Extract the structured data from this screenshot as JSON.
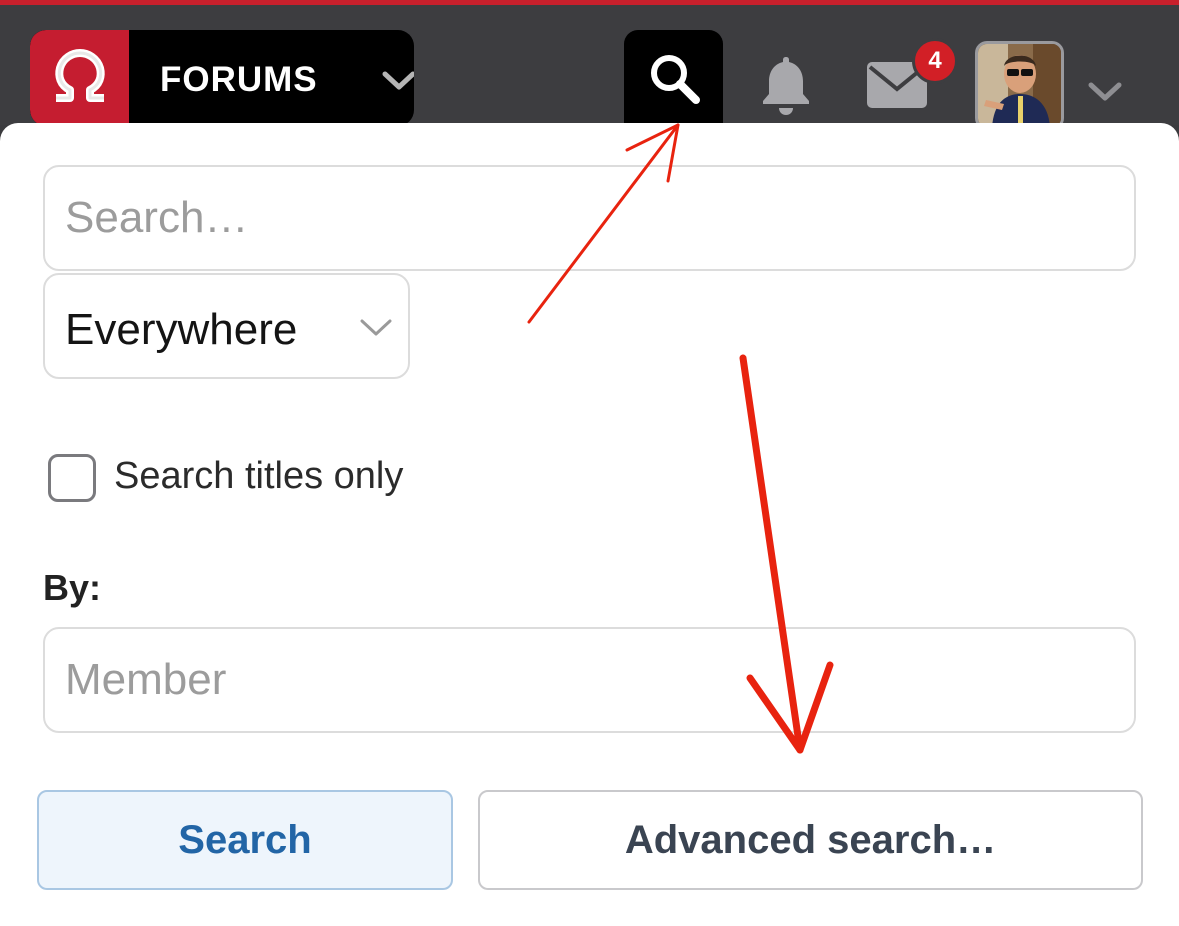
{
  "header": {
    "brand_label": "FORUMS",
    "notification_count": "4",
    "icons": {
      "logo": "omega-logo-icon",
      "brand_menu": "chevron-down-icon",
      "search": "search-icon",
      "notifications": "bell-icon",
      "messages": "envelope-icon",
      "user_menu": "chevron-down-icon"
    }
  },
  "search_panel": {
    "query_placeholder": "Search…",
    "scope_value": "Everywhere",
    "titles_only_label": "Search titles only",
    "titles_only_checked": false,
    "by_label": "By:",
    "member_placeholder": "Member",
    "search_button": "Search",
    "advanced_button": "Advanced search…"
  },
  "colors": {
    "accent_red": "#c8202c",
    "header_bg": "#3d3d40",
    "search_button_text": "#2265a6",
    "badge": "#d21f26",
    "annotation_arrow": "#e8230f"
  }
}
